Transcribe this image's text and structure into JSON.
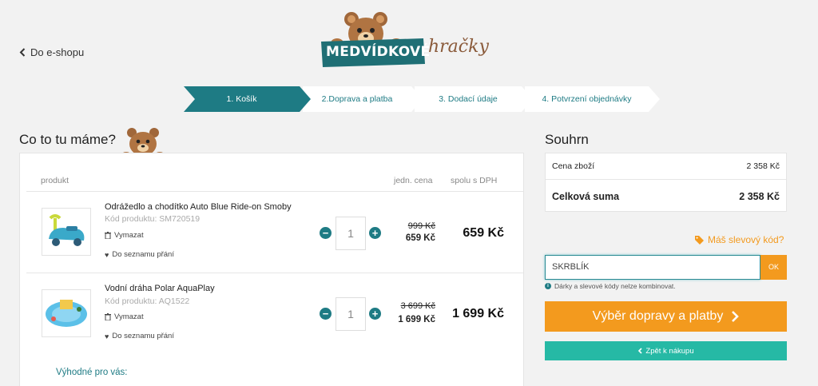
{
  "header": {
    "back_label": "Do e-shopu",
    "logo_word": "MEDVÍDKOVÉ",
    "logo_script": "hračky"
  },
  "steps": [
    {
      "label": "1. Košík",
      "active": true
    },
    {
      "label": "2.Doprava a platba",
      "active": false
    },
    {
      "label": "3. Dodací údaje",
      "active": false
    },
    {
      "label": "4. Potvrzení objednávky",
      "active": false
    }
  ],
  "cart": {
    "title": "Co to tu máme?",
    "columns": {
      "product": "produkt",
      "unit_price": "jedn. cena",
      "total": "spolu s DPH"
    },
    "items": [
      {
        "name": "Odrážedlo a chodítko Auto Blue Ride-on Smoby",
        "code": "Kód produktu: SM720519",
        "remove": "Vymazat",
        "wishlist": "Do seznamu přání",
        "qty": "1",
        "old_price": "999 Kč",
        "unit_price": "659 Kč",
        "total": "659 Kč"
      },
      {
        "name": "Vodní dráha Polar AquaPlay",
        "code": "Kód produktu: AQ1522",
        "remove": "Vymazat",
        "wishlist": "Do seznamu přání",
        "qty": "1",
        "old_price": "3 699 Kč",
        "unit_price": "1 699 Kč",
        "total": "1 699 Kč"
      }
    ],
    "benefits_label": "Výhodné pro vás:"
  },
  "summary": {
    "title": "Souhrn",
    "goods_label": "Cena zboží",
    "goods_value": "2 358 Kč",
    "total_label": "Celková suma",
    "total_value": "2 358 Kč"
  },
  "discount": {
    "link_label": "Máš slevový kód?",
    "input_value": "SKRBLÍK",
    "ok_label": "OK",
    "note": "Dárky a slevové kódy nelze kombinovat."
  },
  "actions": {
    "continue_label": "Výběr dopravy a platby",
    "back_label": "Zpět k nákupu"
  },
  "colors": {
    "teal": "#1e7b84",
    "orange": "#f39a1e",
    "green": "#26b9a5"
  }
}
